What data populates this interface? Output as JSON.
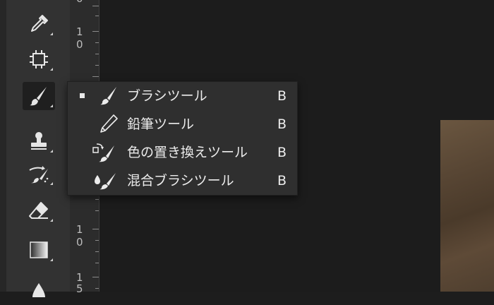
{
  "ruler": {
    "top_fragment": "0",
    "label_a_1": "1",
    "label_a_2": "0",
    "label_b_1": "1",
    "label_b_2": "0",
    "label_c_1": "1",
    "label_c_2": "5"
  },
  "toolbar": {
    "active_tool": "brush-tool",
    "tools": [
      "eyedropper-tool",
      "artboard-tool",
      "brush-tool",
      "stamp-tool",
      "history-brush-tool",
      "eraser-tool",
      "gradient-tool",
      "blur-tool"
    ]
  },
  "flyout": {
    "items": [
      {
        "label": "ブラシツール",
        "shortcut": "B",
        "icon": "brush-icon",
        "selected": true
      },
      {
        "label": "鉛筆ツール",
        "shortcut": "B",
        "icon": "pencil-icon",
        "selected": false
      },
      {
        "label": "色の置き換えツール",
        "shortcut": "B",
        "icon": "color-replacement-icon",
        "selected": false
      },
      {
        "label": "混合ブラシツール",
        "shortcut": "B",
        "icon": "mixer-brush-icon",
        "selected": false
      }
    ]
  },
  "colors": {
    "toolbar_bg": "#323232",
    "canvas_bg": "#1c1c1c",
    "flyout_bg": "#2f2f2f",
    "text": "#ececec"
  }
}
